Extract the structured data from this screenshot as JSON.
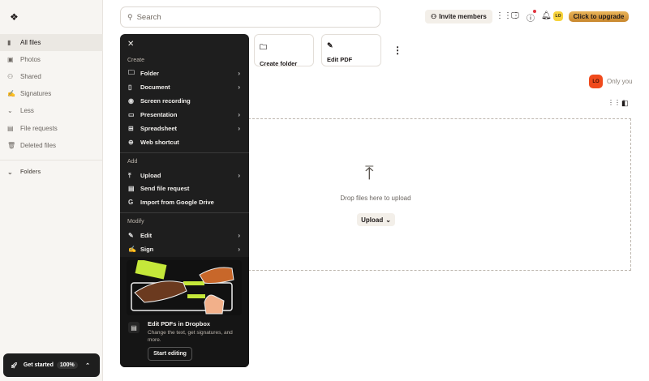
{
  "sidebar": {
    "items": [
      {
        "label": "All files",
        "icon": "people-icon"
      },
      {
        "label": "Photos",
        "icon": "photo-icon"
      },
      {
        "label": "Shared",
        "icon": "shared-icon"
      },
      {
        "label": "Signatures",
        "icon": "signature-icon"
      },
      {
        "label": "Less",
        "icon": "chevron-down-icon"
      },
      {
        "label": "File requests",
        "icon": "file-request-icon"
      },
      {
        "label": "Deleted files",
        "icon": "trash-icon"
      }
    ],
    "folders": "Folders",
    "get_started": "Get started",
    "progress": "100%"
  },
  "search": {
    "placeholder": "Search"
  },
  "topbar": {
    "invite": "Invite members",
    "avatar": "LO",
    "upgrade": "Click to upgrade"
  },
  "menu": {
    "create": "Create",
    "create_items": [
      {
        "label": "Folder"
      },
      {
        "label": "Document"
      },
      {
        "label": "Screen recording"
      },
      {
        "label": "Presentation"
      },
      {
        "label": "Spreadsheet"
      },
      {
        "label": "Web shortcut"
      }
    ],
    "add": "Add",
    "add_items": [
      {
        "label": "Upload"
      },
      {
        "label": "Send file request"
      },
      {
        "label": "Import from Google Drive"
      }
    ],
    "modify": "Modify",
    "modify_items": [
      {
        "label": "Edit"
      },
      {
        "label": "Sign"
      }
    ],
    "promo_title": "Edit PDFs in Dropbox",
    "promo_text": "Change the text, get signatures, and more.",
    "promo_button": "Start editing"
  },
  "cards": [
    {
      "label": "Create folder"
    },
    {
      "label": "Edit PDF"
    }
  ],
  "sharing": {
    "avatar": "LO",
    "text": "Only you"
  },
  "drop": {
    "text": "Drop files here to upload",
    "button": "Upload"
  }
}
